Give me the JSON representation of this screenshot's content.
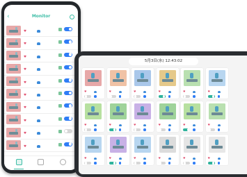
{
  "phone": {
    "app_title": "Monitor"
  },
  "tablet": {
    "datetime": "5月3日(水) 12:43:02"
  },
  "colors": {
    "accent": "#3dbda6",
    "toggle_on_blue": "#2f7df6",
    "toggle_on_teal": "#2fb39c",
    "heart": "#e0506f",
    "lungs": "#3b8ad9"
  }
}
